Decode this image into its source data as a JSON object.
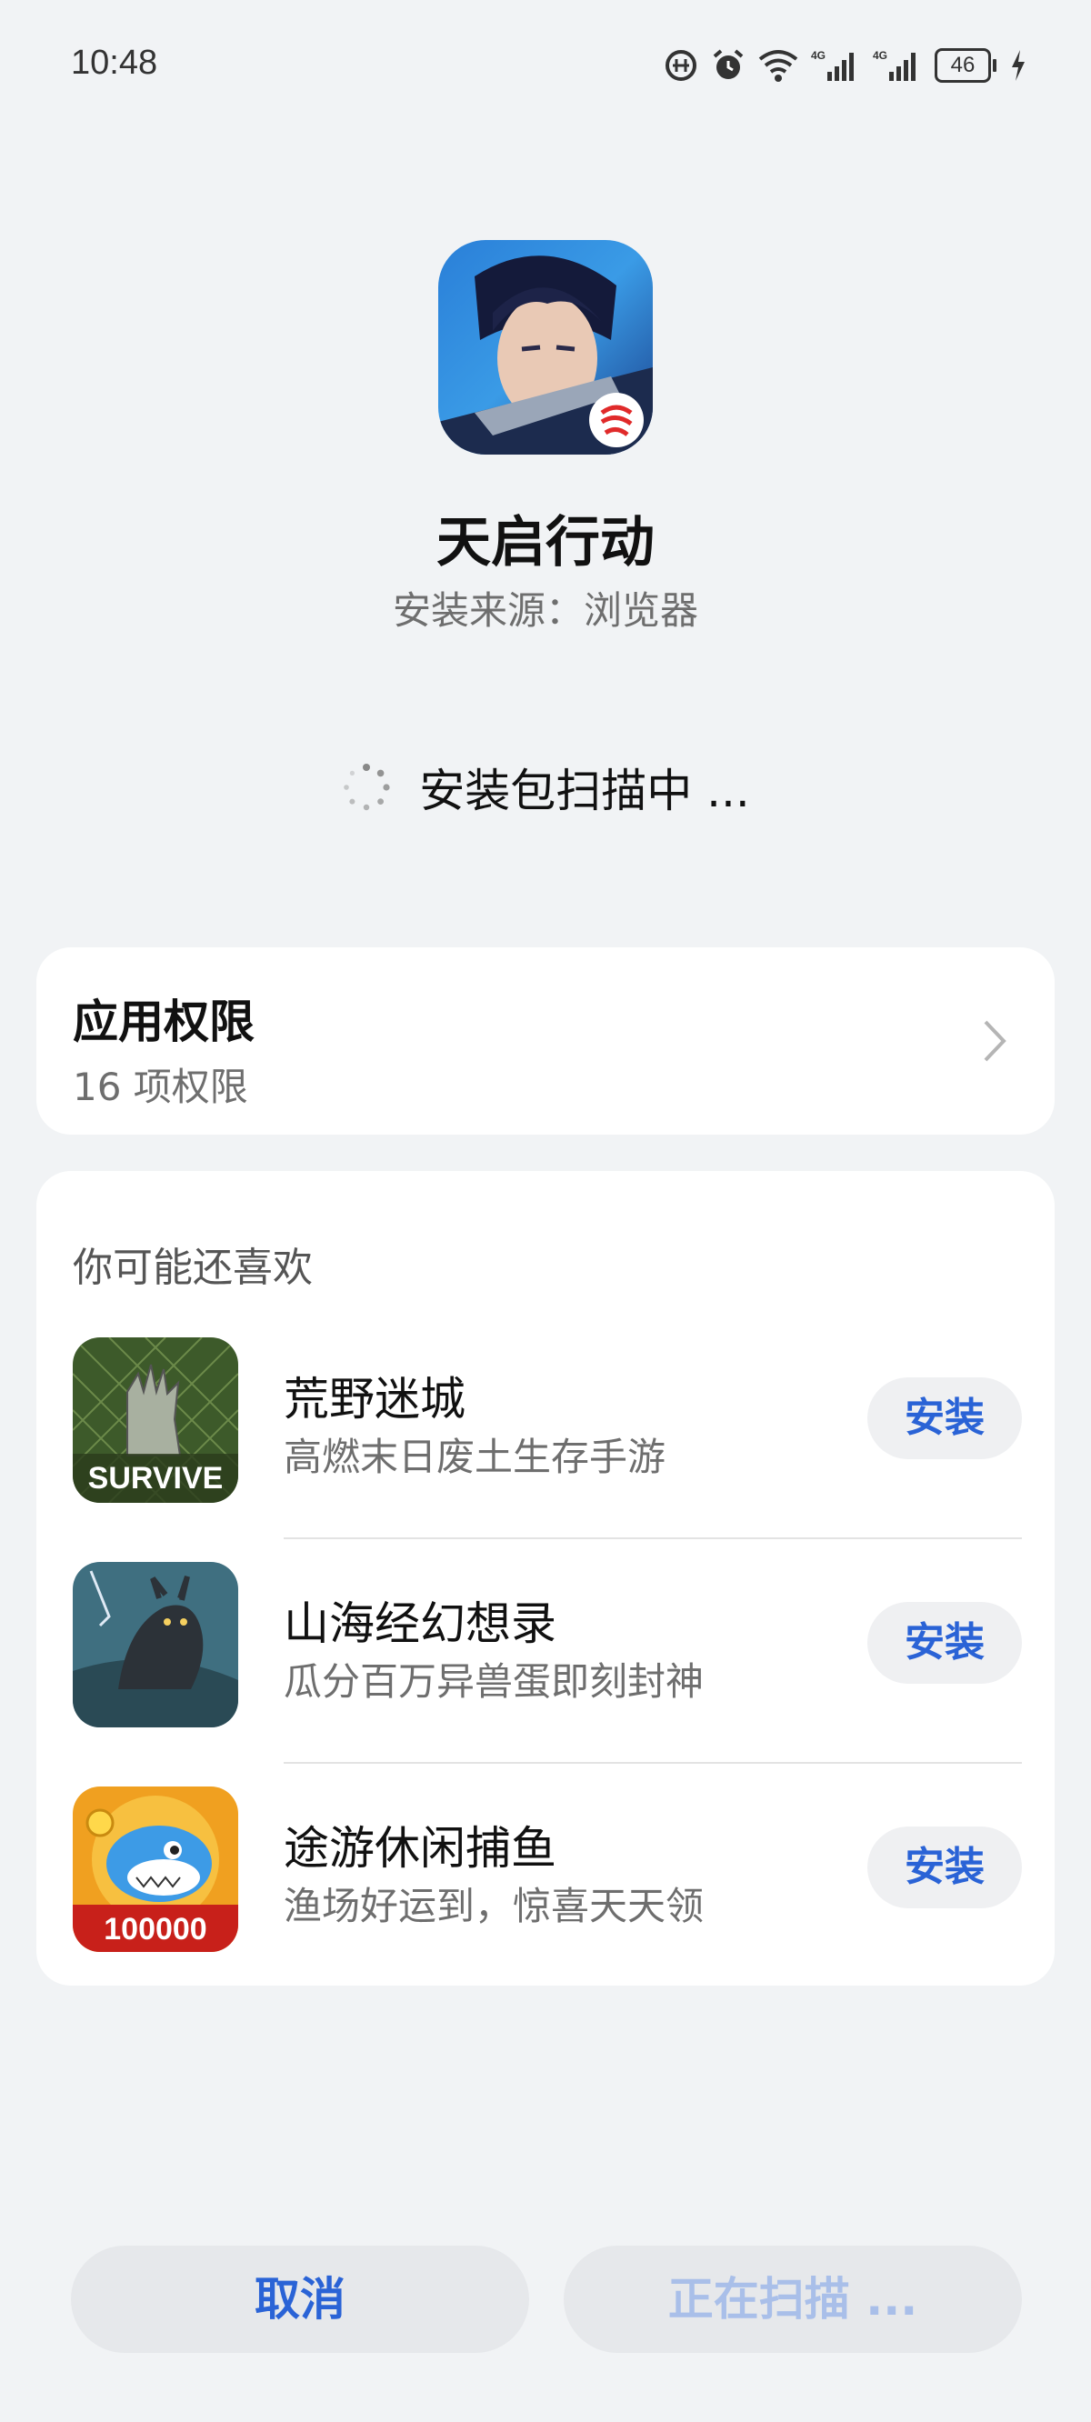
{
  "status_bar": {
    "time": "10:48",
    "icons": [
      "data-saver-icon",
      "alarm-icon",
      "wifi-icon",
      "signal-4g-icon",
      "signal-4g-icon"
    ],
    "battery_level": "46",
    "charging": true
  },
  "app": {
    "name": "天启行动",
    "source": "安装来源：浏览器",
    "icon": "game-hero-icon"
  },
  "scan": {
    "text": "安装包扫描中 ..."
  },
  "permissions": {
    "title": "应用权限",
    "subtitle": "16 项权限"
  },
  "recommendations": {
    "header": "你可能还喜欢",
    "items": [
      {
        "name": "荒野迷城",
        "desc": "高燃末日废土生存手游",
        "button": "安装",
        "icon_text": "SURVIVE"
      },
      {
        "name": "山海经幻想录",
        "desc": "瓜分百万异兽蛋即刻封神",
        "button": "安装",
        "icon_text": ""
      },
      {
        "name": "途游休闲捕鱼",
        "desc": "渔场好运到，惊喜天天领",
        "button": "安装",
        "icon_text": "100000"
      }
    ]
  },
  "buttons": {
    "cancel": "取消",
    "scanning": "正在扫描 ..."
  },
  "colors": {
    "accent": "#2a63d6",
    "accent_disabled": "#a9bfe9",
    "background": "#f1f3f5"
  }
}
